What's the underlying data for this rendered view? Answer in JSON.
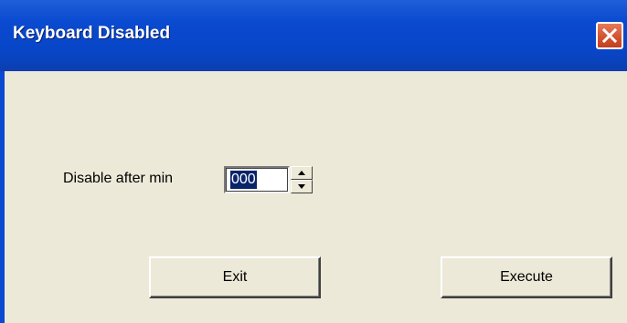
{
  "window": {
    "title": "Keyboard Disabled",
    "close_icon": "close-icon",
    "titlebar_color": "#0a4ad0",
    "close_color": "#d2512c"
  },
  "form": {
    "disable_label": "Disable after min",
    "minutes_value": "000",
    "spin_up_icon": "arrow-up-icon",
    "spin_down_icon": "arrow-down-icon"
  },
  "buttons": {
    "exit_label": "Exit",
    "execute_label": "Execute"
  }
}
